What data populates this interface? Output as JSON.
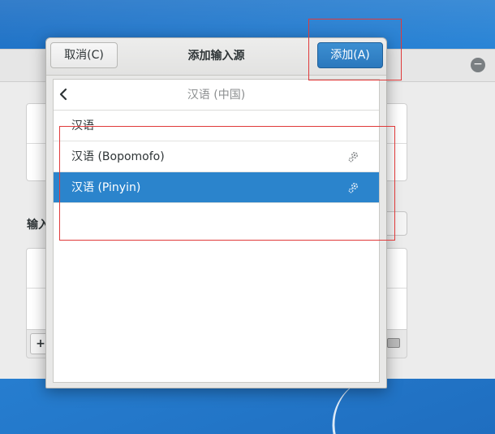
{
  "dialog": {
    "title": "添加输入源",
    "cancel_label": "取消(C)",
    "add_label": "添加(A)",
    "back_title": "汉语 (中国)",
    "items": [
      {
        "label": "汉语",
        "has_settings": false,
        "selected": false
      },
      {
        "label": "汉语 (Bopomofo)",
        "has_settings": true,
        "selected": false
      },
      {
        "label": "汉语 (Pinyin)",
        "has_settings": true,
        "selected": true
      }
    ]
  },
  "background_window": {
    "section_fragment": "输入"
  },
  "colors": {
    "accent": "#2b84cc",
    "annotation": "#e03a3a"
  },
  "icons": {
    "back": "chevron-left-icon",
    "settings": "gear-icon",
    "close": "close-icon",
    "add": "plus-icon",
    "keyboard": "keyboard-icon"
  }
}
